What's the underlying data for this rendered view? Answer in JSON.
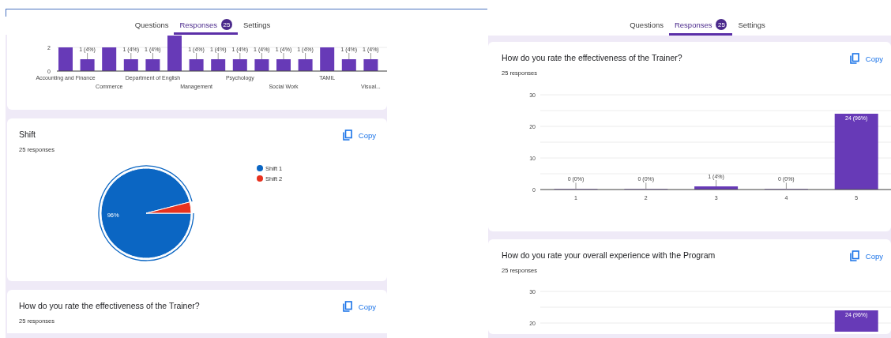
{
  "panels": [
    {
      "tabs": [
        {
          "label": "Questions",
          "selected": false
        },
        {
          "label": "Responses",
          "selected": true,
          "badge": "25"
        },
        {
          "label": "Settings",
          "selected": false
        }
      ],
      "cards": [
        {
          "kind": "chart",
          "chart_data": {
            "type": "bar",
            "values": [
              2,
              1,
              2,
              1,
              1,
              3,
              1,
              1,
              1,
              1,
              1,
              1,
              2,
              1,
              1
            ],
            "ylim": [
              0,
              3
            ],
            "yticks": [
              0,
              2
            ],
            "categories": [
              "Accounting and Finance",
              null,
              "Commerce",
              null,
              "Department of English",
              null,
              "Management",
              null,
              "Psychology",
              null,
              "Social Work",
              null,
              "TAMIL",
              null,
              "Visual..."
            ],
            "value_labels": [
              null,
              "1 (4%)",
              null,
              "1 (4%)",
              "1 (4%)",
              null,
              "1 (4%)",
              "1 (4%)",
              "1 (4%)",
              "1 (4%)",
              "1 (4%)",
              "1 (4%)",
              null,
              "1 (4%)",
              "1 (4%)"
            ]
          }
        },
        {
          "kind": "question",
          "title": "Shift",
          "responses": "25 responses",
          "copy": "Copy",
          "chart_data": {
            "type": "pie",
            "categories": [
              "Shift 1",
              "Shift 2"
            ],
            "values": [
              96,
              4
            ],
            "colors": [
              "#0b66c3",
              "#e8321f"
            ],
            "legend": true,
            "value_labels": [
              "96%",
              null
            ]
          }
        },
        {
          "kind": "question",
          "title": "How do you rate the effectiveness of the Trainer?",
          "responses": "25 responses",
          "copy": "Copy"
        }
      ]
    },
    {
      "tabs": [
        {
          "label": "Questions",
          "selected": false
        },
        {
          "label": "Responses",
          "selected": true,
          "badge": "25"
        },
        {
          "label": "Settings",
          "selected": false
        }
      ],
      "cards": [
        {
          "kind": "question",
          "title": "How do you rate the effectiveness of the Trainer?",
          "responses": "25 responses",
          "copy": "Copy",
          "chart_data": {
            "type": "bar",
            "categories": [
              "1",
              "2",
              "3",
              "4",
              "5"
            ],
            "values": [
              0,
              0,
              1,
              0,
              24
            ],
            "ylim": [
              0,
              30
            ],
            "yticks": [
              0,
              10,
              20,
              30
            ],
            "value_labels": [
              "0 (0%)",
              "0 (0%)",
              "1 (4%)",
              "0 (0%)",
              "24 (96%)"
            ]
          }
        },
        {
          "kind": "question",
          "title": "How do you rate your overall experience with the Program",
          "responses": "25 responses",
          "copy": "Copy",
          "chart_data": {
            "type": "bar",
            "values": [
              null,
              null,
              null,
              null,
              24
            ],
            "ylim": [
              0,
              30
            ],
            "yticks": [
              20,
              30
            ],
            "value_labels": [
              null,
              null,
              null,
              null,
              "24 (96%)"
            ]
          }
        }
      ]
    }
  ]
}
